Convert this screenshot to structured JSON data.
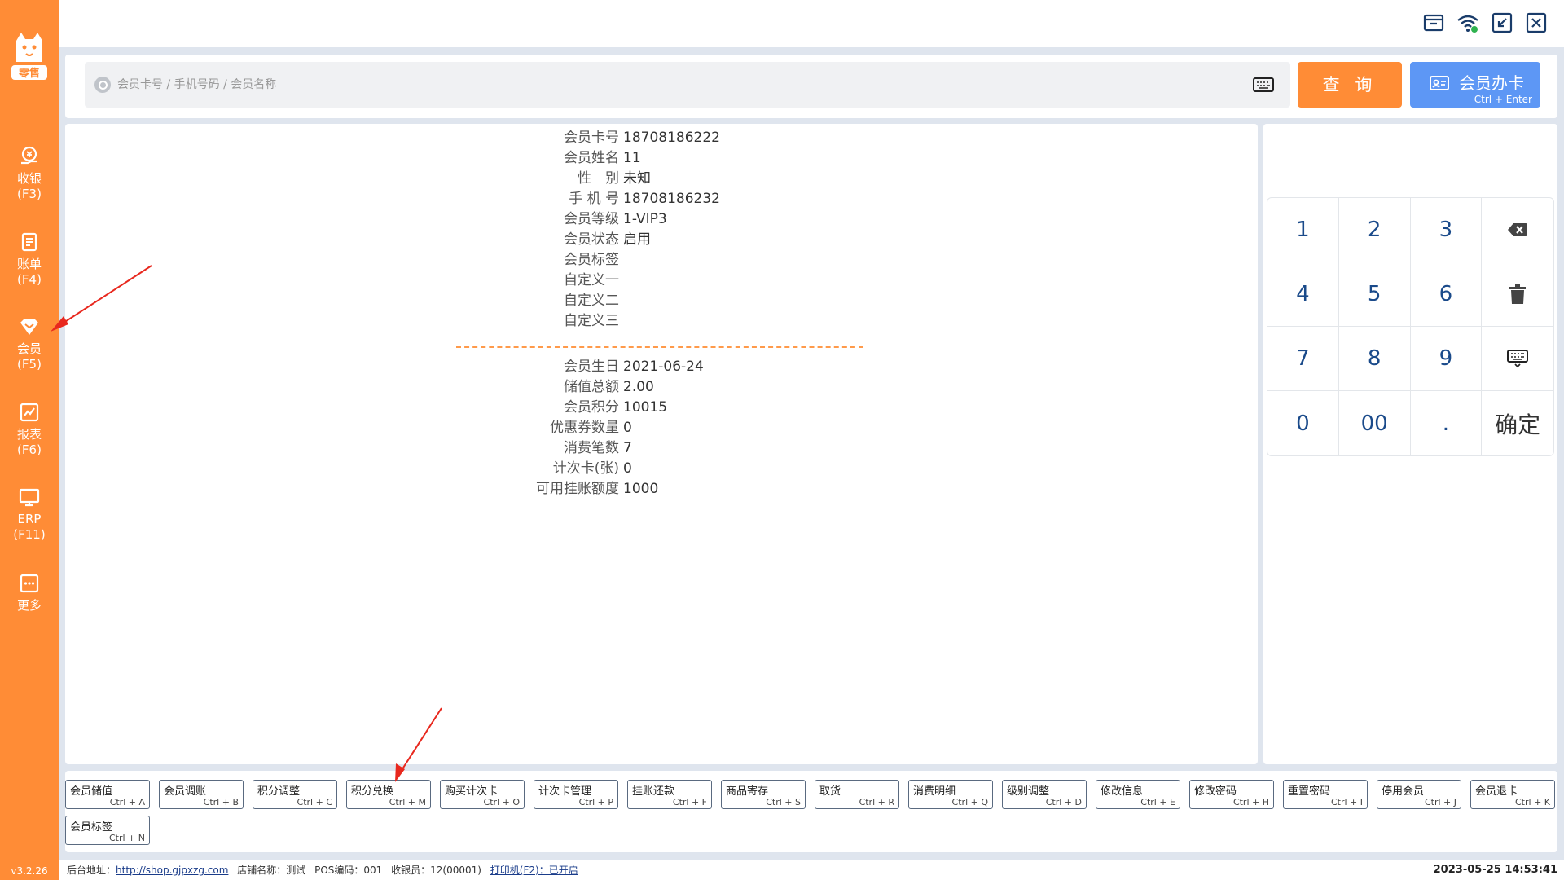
{
  "sidebar": {
    "logo_text": "零售",
    "items": [
      {
        "label": "收银",
        "shortcut": "(F3)",
        "icon": "cashier-icon"
      },
      {
        "label": "账单",
        "shortcut": "(F4)",
        "icon": "bill-icon"
      },
      {
        "label": "会员",
        "shortcut": "(F5)",
        "icon": "member-icon"
      },
      {
        "label": "报表",
        "shortcut": "(F6)",
        "icon": "report-icon"
      },
      {
        "label": "ERP",
        "shortcut": "(F11)",
        "icon": "erp-icon"
      },
      {
        "label": "更多",
        "shortcut": "",
        "icon": "more-icon"
      }
    ],
    "active": "会员",
    "version": "v3.2.26"
  },
  "search": {
    "placeholder": "会员卡号 / 手机号码 / 会员名称",
    "query_label": "查 询",
    "card_label": "会员办卡",
    "card_shortcut": "Ctrl + Enter"
  },
  "member_info": [
    {
      "key": "会员卡号",
      "value": "18708186222"
    },
    {
      "key": "会员姓名",
      "value": "11"
    },
    {
      "key": "性　别",
      "value": "未知"
    },
    {
      "key": "手 机 号",
      "value": "18708186232"
    },
    {
      "key": "会员等级",
      "value": "1-VIP3"
    },
    {
      "key": "会员状态",
      "value": "启用"
    },
    {
      "key": "会员标签",
      "value": ""
    },
    {
      "key": "自定义一",
      "value": ""
    },
    {
      "key": "自定义二",
      "value": ""
    },
    {
      "key": "自定义三",
      "value": ""
    }
  ],
  "member_stats": [
    {
      "key": "会员生日",
      "value": "2021-06-24"
    },
    {
      "key": "储值总额",
      "value": "2.00"
    },
    {
      "key": "会员积分",
      "value": "10015"
    },
    {
      "key": "优惠券数量",
      "value": "0"
    },
    {
      "key": "消费笔数",
      "value": "7"
    },
    {
      "key": "计次卡(张)",
      "value": "0"
    },
    {
      "key": "可用挂账额度",
      "value": "1000"
    }
  ],
  "keypad": [
    "1",
    "2",
    "3",
    "backspace",
    "4",
    "5",
    "6",
    "clear",
    "7",
    "8",
    "9",
    "keyboard",
    "0",
    "00",
    ".",
    "确定"
  ],
  "functions": [
    {
      "label": "会员储值",
      "shortcut": "Ctrl + A"
    },
    {
      "label": "会员调账",
      "shortcut": "Ctrl + B"
    },
    {
      "label": "积分调整",
      "shortcut": "Ctrl + C"
    },
    {
      "label": "积分兑换",
      "shortcut": "Ctrl + M"
    },
    {
      "label": "购买计次卡",
      "shortcut": "Ctrl + O"
    },
    {
      "label": "计次卡管理",
      "shortcut": "Ctrl + P"
    },
    {
      "label": "挂账还款",
      "shortcut": "Ctrl + F"
    },
    {
      "label": "商品寄存",
      "shortcut": "Ctrl + S"
    },
    {
      "label": "取货",
      "shortcut": "Ctrl + R"
    },
    {
      "label": "消费明细",
      "shortcut": "Ctrl + Q"
    },
    {
      "label": "级别调整",
      "shortcut": "Ctrl + D"
    },
    {
      "label": "修改信息",
      "shortcut": "Ctrl + E"
    },
    {
      "label": "修改密码",
      "shortcut": "Ctrl + H"
    },
    {
      "label": "重置密码",
      "shortcut": "Ctrl + I"
    },
    {
      "label": "停用会员",
      "shortcut": "Ctrl + J"
    },
    {
      "label": "会员退卡",
      "shortcut": "Ctrl + K"
    },
    {
      "label": "会员标签",
      "shortcut": "Ctrl + N"
    }
  ],
  "status": {
    "backend_label": "后台地址：",
    "backend_url": "http://shop.gjpxzg.com",
    "shop": "店铺名称：测试",
    "pos": "POS编码：001",
    "cashier": "收银员：12(00001)",
    "printer": "打印机(F2)：已开启",
    "datetime": "2023-05-25 14:53:41"
  },
  "colors": {
    "accent": "#ff8c36",
    "primary_blue": "#5d97f5",
    "annotation_arrow": "#e8281e"
  }
}
